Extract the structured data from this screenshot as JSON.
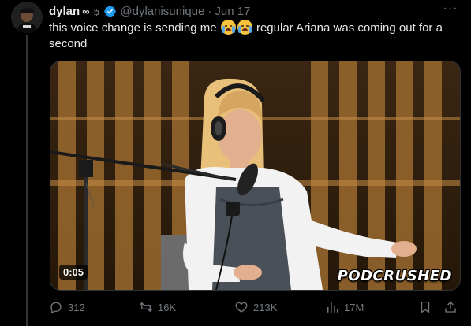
{
  "tweet": {
    "author_name": "dylan",
    "author_badges": [
      "∞",
      "☼"
    ],
    "handle": "@dylanisunique",
    "separator": "·",
    "date": "Jun 17",
    "text_before": "this voice change is sending me",
    "text_after": "regular Ariana was coming out for a second",
    "emojis": [
      "loudly-crying-face",
      "loudly-crying-face"
    ]
  },
  "media": {
    "timestamp": "0:05",
    "watermark": "PODCRUSHED",
    "scene": "woman-with-headphones-at-podcast-microphone"
  },
  "actions": {
    "replies": "312",
    "reposts": "16K",
    "likes": "213K",
    "views": "17M"
  },
  "colors": {
    "background": "#000000",
    "text_primary": "#e7e9ea",
    "text_secondary": "#71767b",
    "verified": "#1d9bf0"
  }
}
